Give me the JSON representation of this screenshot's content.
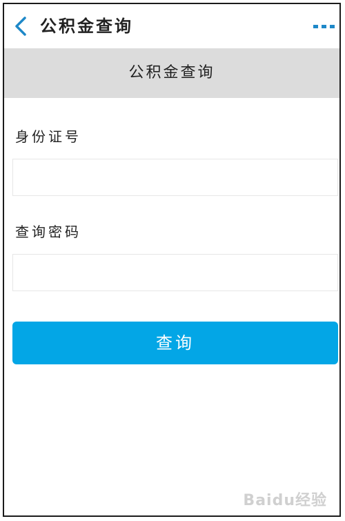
{
  "navbar": {
    "back_icon": "chevron-left-icon",
    "title": "公积金查询",
    "more_icon": "more-dots-icon",
    "accent": "#1e88c8"
  },
  "banner": {
    "title": "公积金查询",
    "background": "#dcdcdc"
  },
  "form": {
    "id_label": "身份证号",
    "id_value": "",
    "password_label": "查询密码",
    "password_value": "",
    "submit_label": "查询",
    "submit_color": "#03a6e6"
  },
  "watermark": {
    "text": "Baidu经验"
  }
}
